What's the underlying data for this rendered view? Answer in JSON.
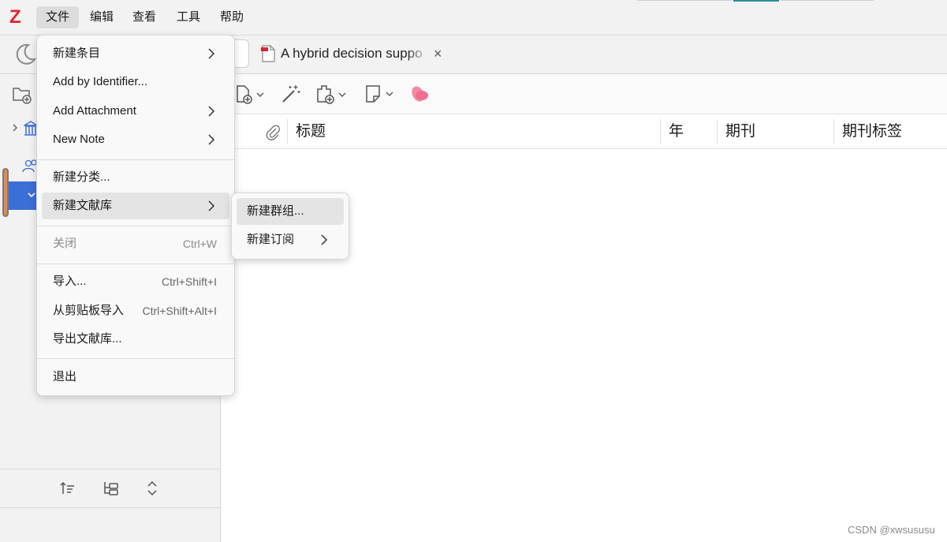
{
  "app": {
    "logo": "Z",
    "menubar": [
      "文件",
      "编辑",
      "查看",
      "工具",
      "帮助"
    ]
  },
  "tabs": {
    "reader_tab_label": "A hybrid decision suppo",
    "close": "×"
  },
  "columns": {
    "title": "标题",
    "year": "年",
    "journal": "期刊",
    "journal_tag": "期刊标签"
  },
  "file_menu": {
    "new_item": "新建条目",
    "add_by_identifier": "Add by Identifier...",
    "add_attachment": "Add Attachment",
    "new_note": "New Note",
    "new_collection": "新建分类...",
    "new_library": "新建文献库",
    "close": "关闭",
    "close_shortcut": "Ctrl+W",
    "import": "导入...",
    "import_shortcut": "Ctrl+Shift+I",
    "import_clipboard": "从剪贴板导入",
    "import_clipboard_shortcut": "Ctrl+Shift+Alt+I",
    "export_library": "导出文献库...",
    "quit": "退出"
  },
  "submenu": {
    "new_group": "新建群组...",
    "new_feed": "新建订阅"
  },
  "watermark": "CSDN @xwsususu",
  "colors": {
    "logo_red": "#e0242d",
    "selection_blue": "#3a6fd8",
    "annotation_pink": "#ef6f8f",
    "scroll_thumb": "#e58a4a"
  },
  "icons": [
    "moon-icon",
    "pdf-icon",
    "new-collection-icon",
    "library-icon",
    "group-icon",
    "new-item-icon",
    "magic-wand-icon",
    "add-attachment-icon",
    "new-note-icon",
    "annotation-icon",
    "paperclip-icon",
    "sort-icon",
    "tree-icon",
    "expand-collapse-icon"
  ]
}
